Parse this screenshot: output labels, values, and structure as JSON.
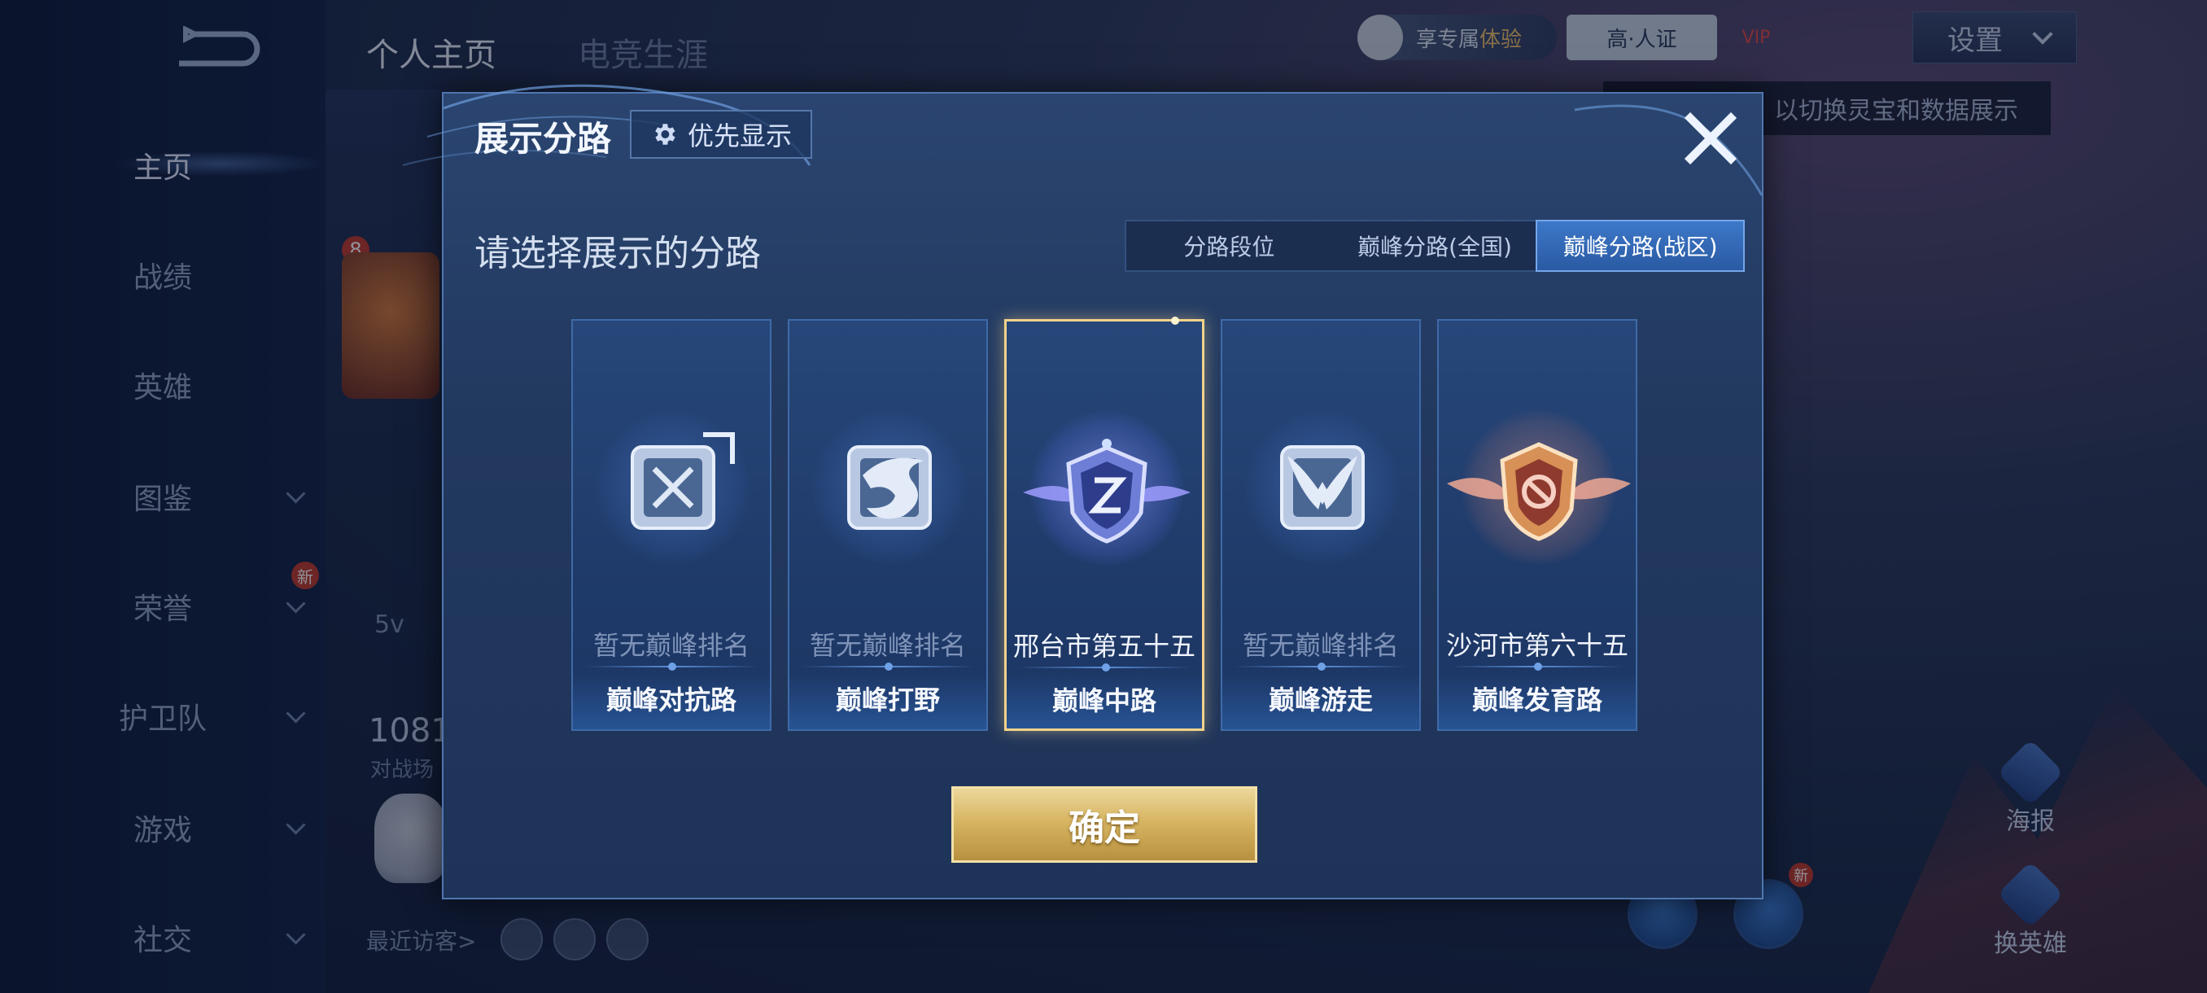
{
  "background": {
    "top_tabs": [
      "个人主页",
      "电竞生涯"
    ],
    "nav_items": [
      {
        "label": "主页",
        "active": true,
        "chevron": false
      },
      {
        "label": "战绩",
        "active": false,
        "chevron": false
      },
      {
        "label": "英雄",
        "active": false,
        "chevron": false
      },
      {
        "label": "图鉴",
        "active": false,
        "chevron": true
      },
      {
        "label": "荣誉",
        "active": false,
        "chevron": true
      },
      {
        "label": "护卫队",
        "active": false,
        "chevron": true
      },
      {
        "label": "游戏",
        "active": false,
        "chevron": true
      },
      {
        "label": "社交",
        "active": false,
        "chevron": true
      }
    ],
    "new_badge": "新",
    "level_badge": "8",
    "partial_text": "5v",
    "stat_number": "1081",
    "stat_label": "对战场",
    "recent_visitors": "最近访客>",
    "exclusive_pill": "享专属",
    "exclusive_pill_highlight": "体验",
    "cert_pill": "高·人证",
    "vip": "VIP",
    "settings_label": "设置",
    "tooltip": "以切换灵宝和数据展示",
    "poster_label": "海报",
    "switch_hero_label": "换英雄",
    "side_new_badge": "新"
  },
  "modal": {
    "title": "展示分路",
    "priority_button": "优先显示",
    "subtitle": "请选择展示的分路",
    "tabs": [
      {
        "label": "分路段位",
        "selected": false
      },
      {
        "label": "巅峰分路(全国)",
        "selected": false
      },
      {
        "label": "巅峰分路(战区)",
        "selected": true
      }
    ],
    "cards": [
      {
        "rank": "暂无巅峰排名",
        "lane": "巅峰对抗路",
        "selected": false,
        "icon": "sword-icon"
      },
      {
        "rank": "暂无巅峰排名",
        "lane": "巅峰打野",
        "selected": false,
        "icon": "dragon-icon"
      },
      {
        "rank": "邢台市第五十五",
        "lane": "巅峰中路",
        "selected": true,
        "icon": "mid-shield-icon"
      },
      {
        "rank": "暂无巅峰排名",
        "lane": "巅峰游走",
        "selected": false,
        "icon": "wings-icon"
      },
      {
        "rank": "沙河市第六十五",
        "lane": "巅峰发育路",
        "selected": false,
        "icon": "adc-shield-icon"
      }
    ],
    "confirm_button": "确定"
  },
  "colors": {
    "selected_border": "#f3d28a",
    "accent_blue": "#3d78c9",
    "gold": "#d7b563"
  }
}
